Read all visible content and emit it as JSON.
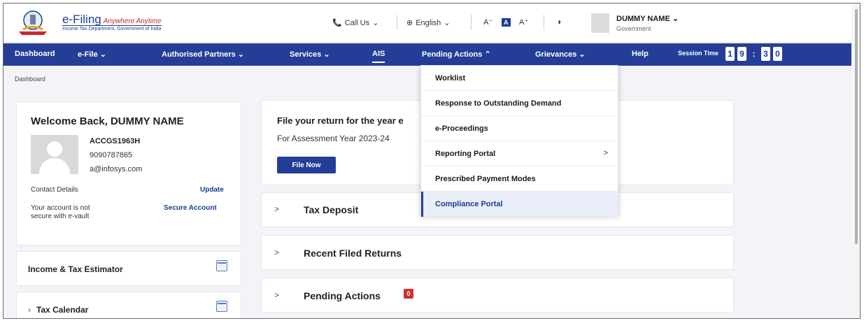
{
  "header": {
    "logo_title": "e-Filing",
    "logo_tagline": "Anywhere Anytime",
    "logo_subtitle": "Income Tax Department, Government of India",
    "call_us": "Call Us",
    "language": "English",
    "font_decrease": "A⁻",
    "font_normal": "A",
    "font_increase": "A⁺",
    "user_name": "DUMMY NAME",
    "user_role": "Government"
  },
  "nav": {
    "items": [
      "Dashboard",
      "e-File",
      "Authorised Partners",
      "Services",
      "AIS",
      "Pending Actions",
      "Grievances",
      "Help"
    ],
    "session_label": "Session Time",
    "session_digits": [
      "1",
      "9",
      ":",
      "3",
      "0"
    ]
  },
  "breadcrumb": "Dashboard",
  "profile": {
    "welcome": "Welcome Back, DUMMY NAME",
    "pan": "ACCGS1963H",
    "phone": "9090787865",
    "email": "a@infosys.com",
    "contact_label": "Contact Details",
    "update_link": "Update",
    "secure_note_1": "Your account is not",
    "secure_note_2": "secure with e-vault",
    "secure_link": "Secure Account"
  },
  "sidebar": {
    "estimator": "Income & Tax Estimator",
    "calendar": "Tax Calendar"
  },
  "file_return": {
    "title": "File your return for the year e",
    "subtitle": "For Assessment Year 2023-24",
    "button": "File Now"
  },
  "accordions": {
    "tax_deposit": "Tax Deposit",
    "recent_returns": "Recent Filed Returns",
    "pending_actions": "Pending Actions",
    "pending_badge": "0"
  },
  "dropdown": {
    "items": [
      "Worklist",
      "Response to Outstanding Demand",
      "e-Proceedings",
      "Reporting Portal",
      "Prescribed Payment Modes",
      "Compliance Portal"
    ]
  },
  "colors": {
    "nav_bg": "#243e98",
    "brand_blue": "#1b3d94",
    "badge_red": "#d32f2f"
  }
}
